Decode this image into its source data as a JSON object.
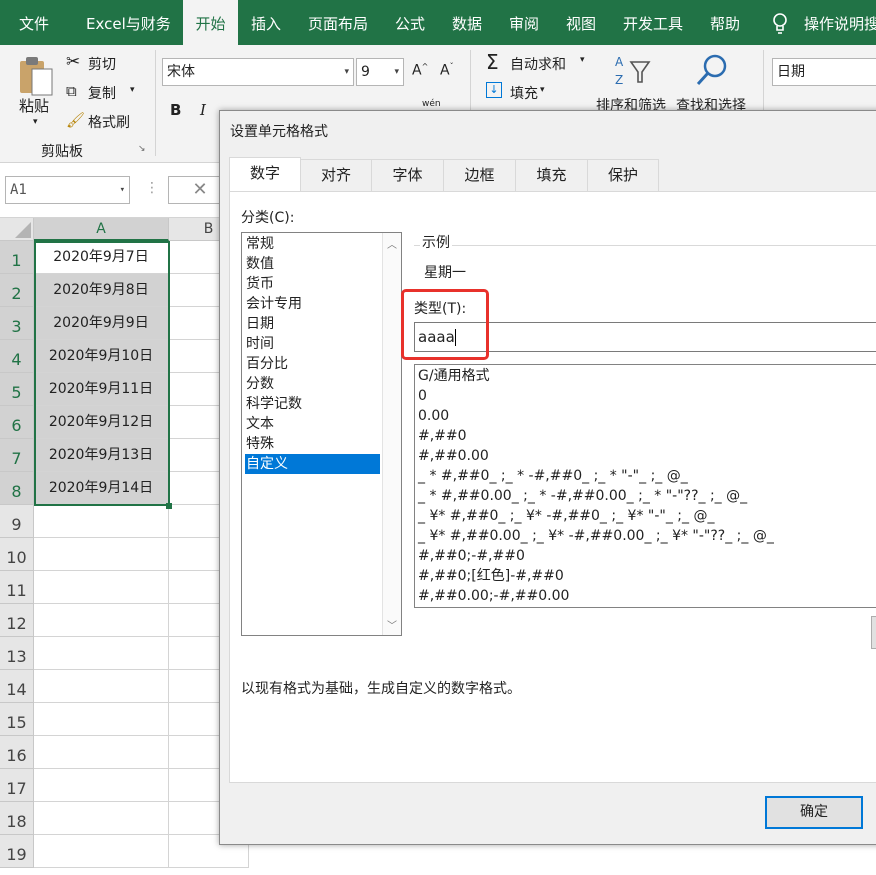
{
  "ribbon_tabs": [
    "文件",
    "Excel与财务",
    "开始",
    "插入",
    "页面布局",
    "公式",
    "数据",
    "审阅",
    "视图",
    "开发工具",
    "帮助"
  ],
  "tell_me": "操作说明搜",
  "clipboard": {
    "paste": "粘贴",
    "cut": "剪切",
    "copy": "复制",
    "painter": "格式刷",
    "group": "剪贴板"
  },
  "font": {
    "name": "宋体",
    "size": "9",
    "bold": "B",
    "italic": "I",
    "phonetic": "wén"
  },
  "editing": {
    "autosum": "自动求和",
    "fill": "填充",
    "sort": "排序和筛选",
    "find": "查找和选择"
  },
  "number_format": "日期",
  "name_box": "A1",
  "columns": [
    "A",
    "B"
  ],
  "rows": [
    "1",
    "2",
    "3",
    "4",
    "5",
    "6",
    "7",
    "8",
    "9",
    "10",
    "11",
    "12",
    "13",
    "14",
    "15",
    "16",
    "17",
    "18",
    "19"
  ],
  "cells": [
    "2020年9月7日",
    "2020年9月8日",
    "2020年9月9日",
    "2020年9月10日",
    "2020年9月11日",
    "2020年9月12日",
    "2020年9月13日",
    "2020年9月14日"
  ],
  "dialog": {
    "title": "设置单元格格式",
    "tabs": [
      "数字",
      "对齐",
      "字体",
      "边框",
      "填充",
      "保护"
    ],
    "category_label": "分类(C):",
    "categories": [
      "常规",
      "数值",
      "货币",
      "会计专用",
      "日期",
      "时间",
      "百分比",
      "分数",
      "科学记数",
      "文本",
      "特殊",
      "自定义"
    ],
    "sample_label": "示例",
    "sample_value": "星期一",
    "type_label": "类型(T):",
    "type_value": "aaaa",
    "formats": [
      "G/通用格式",
      "0",
      "0.00",
      "#,##0",
      "#,##0.00",
      "_ * #,##0_ ;_ * -#,##0_ ;_ * \"-\"_ ;_ @_",
      "_ * #,##0.00_ ;_ * -#,##0.00_ ;_ * \"-\"??_ ;_ @_",
      "_ ¥* #,##0_ ;_ ¥* -#,##0_ ;_ ¥* \"-\"_ ;_ @_",
      "_ ¥* #,##0.00_ ;_ ¥* -#,##0.00_ ;_ ¥* \"-\"??_ ;_ @_",
      "#,##0;-#,##0",
      "#,##0;[红色]-#,##0",
      "#,##0.00;-#,##0.00"
    ],
    "description": "以现有格式为基础，生成自定义的数字格式。",
    "ok": "确定"
  }
}
